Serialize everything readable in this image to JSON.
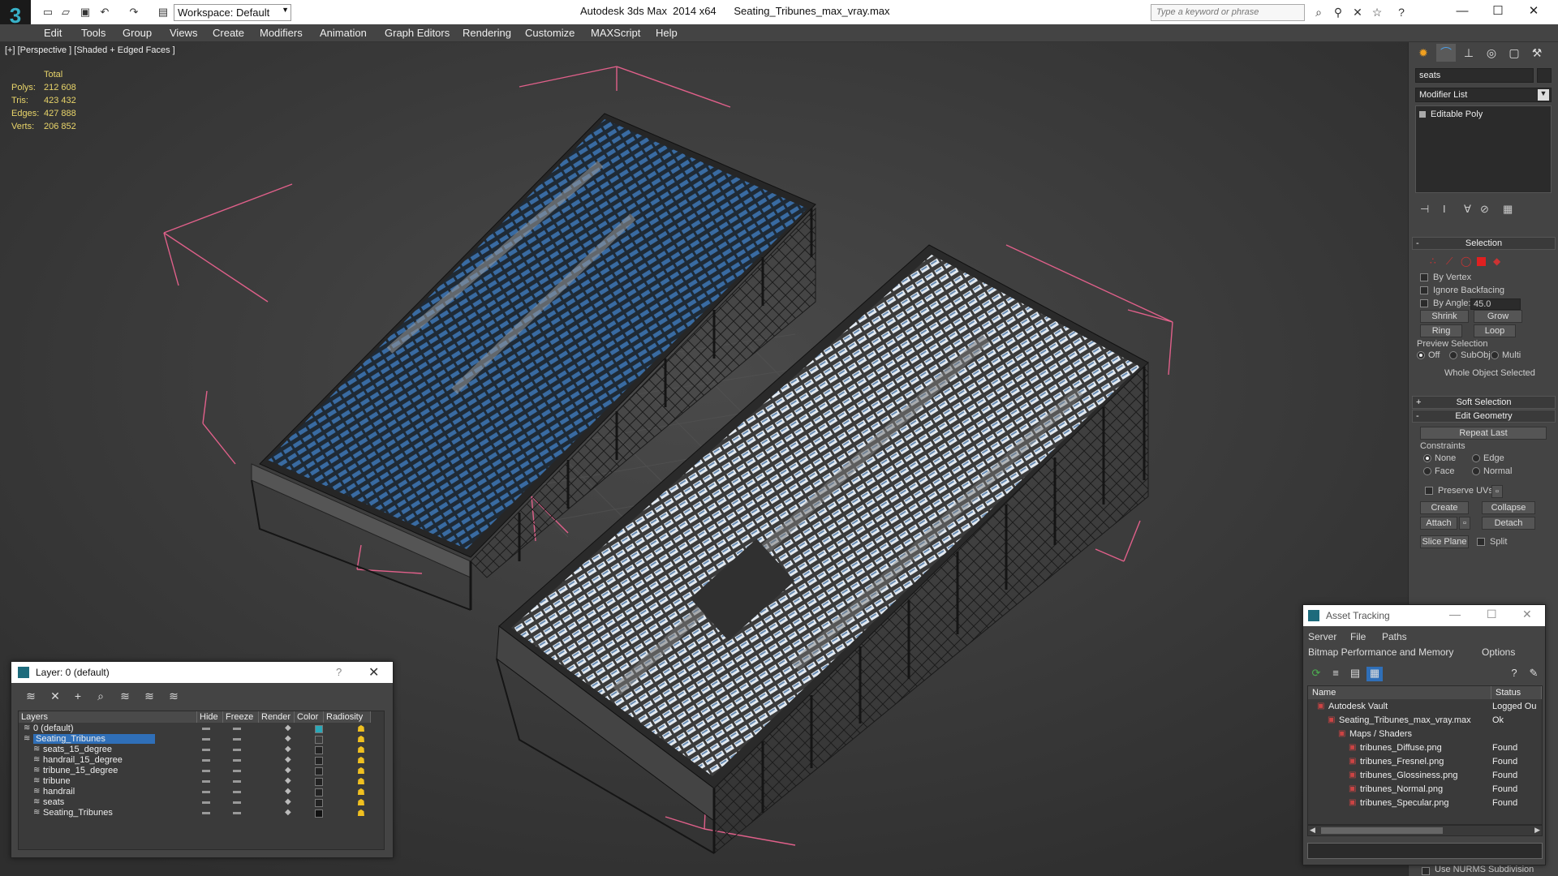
{
  "titlebar": {
    "workspace": "Workspace: Default",
    "app_title": "Autodesk 3ds Max  2014 x64      Seating_Tribunes_max_vray.max",
    "search_placeholder": "Type a keyword or phrase"
  },
  "menu": [
    "Edit",
    "Tools",
    "Group",
    "Views",
    "Create",
    "Modifiers",
    "Animation",
    "Graph Editors",
    "Rendering",
    "Customize",
    "MAXScript",
    "Help"
  ],
  "viewport": {
    "label": "[+] [Perspective ] [Shaded + Edged Faces ]",
    "stats_header": "Total",
    "stats": [
      {
        "k": "Polys:",
        "v": "212 608"
      },
      {
        "k": "Tris:",
        "v": "423 432"
      },
      {
        "k": "Edges:",
        "v": "427 888"
      },
      {
        "k": "Verts:",
        "v": "206 852"
      }
    ]
  },
  "cmdpanel": {
    "object_name": "seats",
    "modifier_list": "Modifier List",
    "stack_item": "Editable Poly",
    "selection": {
      "title": "Selection",
      "by_vertex": "By Vertex",
      "ignore_backfacing": "Ignore Backfacing",
      "by_angle": "By Angle:",
      "angle_value": "45.0",
      "shrink": "Shrink",
      "grow": "Grow",
      "ring": "Ring",
      "loop": "Loop",
      "preview_selection": "Preview Selection",
      "off": "Off",
      "subobj": "SubObj",
      "multi": "Multi",
      "whole_object": "Whole Object Selected"
    },
    "soft_selection": "Soft Selection",
    "edit_geometry": {
      "title": "Edit Geometry",
      "repeat_last": "Repeat Last",
      "constraints": "Constraints",
      "none": "None",
      "edge": "Edge",
      "face": "Face",
      "normal": "Normal",
      "preserve_uvs": "Preserve UVs",
      "create": "Create",
      "collapse": "Collapse",
      "attach": "Attach",
      "detach": "Detach",
      "slice_plane": "Slice Plane",
      "split": "Split"
    },
    "use_nurms": "Use NURMS Subdivision"
  },
  "layer_dialog": {
    "title": "Layer: 0 (default)",
    "help": "?",
    "columns": [
      "Layers",
      "Hide",
      "Freeze",
      "Render",
      "Color",
      "Radiosity"
    ],
    "rows": [
      {
        "name": "0 (default)",
        "indent": 0,
        "color": "#2aa8b8"
      },
      {
        "name": "Seating_Tribunes",
        "indent": 0,
        "color": "#3a3a3a",
        "selected": true
      },
      {
        "name": "seats_15_degree",
        "indent": 1,
        "color": "#222222"
      },
      {
        "name": "handrail_15_degree",
        "indent": 1,
        "color": "#222222"
      },
      {
        "name": "tribune_15_degree",
        "indent": 1,
        "color": "#222222"
      },
      {
        "name": "tribune",
        "indent": 1,
        "color": "#222222"
      },
      {
        "name": "handrail",
        "indent": 1,
        "color": "#222222"
      },
      {
        "name": "seats",
        "indent": 1,
        "color": "#222222"
      },
      {
        "name": "Seating_Tribunes",
        "indent": 1,
        "color": "#111111"
      }
    ]
  },
  "asset_dialog": {
    "title": "Asset Tracking",
    "menu1": [
      "Server",
      "File",
      "Paths"
    ],
    "menu2": [
      "Bitmap Performance and Memory",
      "Options"
    ],
    "columns": [
      "Name",
      "Status"
    ],
    "rows": [
      {
        "name": "Autodesk Vault",
        "status": "Logged Ou",
        "indent": 1
      },
      {
        "name": "Seating_Tribunes_max_vray.max",
        "status": "Ok",
        "indent": 2
      },
      {
        "name": "Maps / Shaders",
        "status": "",
        "indent": 3
      },
      {
        "name": "tribunes_Diffuse.png",
        "status": "Found",
        "indent": 4
      },
      {
        "name": "tribunes_Fresnel.png",
        "status": "Found",
        "indent": 4
      },
      {
        "name": "tribunes_Glossiness.png",
        "status": "Found",
        "indent": 4
      },
      {
        "name": "tribunes_Normal.png",
        "status": "Found",
        "indent": 4
      },
      {
        "name": "tribunes_Specular.png",
        "status": "Found",
        "indent": 4
      }
    ]
  },
  "colors": {
    "accent": "#2f6fb8",
    "stats": "#e9d56a",
    "bbox": "#e0608a",
    "seat_blue": "#3a6fa8"
  }
}
